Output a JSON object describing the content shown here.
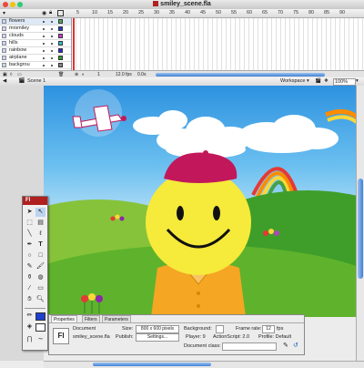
{
  "window": {
    "title": "smiley_scene.fla"
  },
  "timeline": {
    "frame_numbers": [
      "5",
      "10",
      "15",
      "20",
      "25",
      "30",
      "35",
      "40",
      "45",
      "50",
      "55",
      "60",
      "65",
      "70",
      "75",
      "80",
      "85",
      "90"
    ],
    "layers": [
      {
        "name": "flowers",
        "swatch": "#4caf50"
      },
      {
        "name": "mrsmiley",
        "swatch": "#1e3fd0"
      },
      {
        "name": "clouds",
        "swatch": "#d23fd0"
      },
      {
        "name": "hills",
        "swatch": "#25c4d6"
      },
      {
        "name": "rainbow",
        "swatch": "#2b2bd8"
      },
      {
        "name": "airplane",
        "swatch": "#30a030"
      },
      {
        "name": "backgrou",
        "swatch": "#888888"
      }
    ],
    "frame": "1",
    "fps": "12.0 fps",
    "time": "0.0s"
  },
  "editbar": {
    "scene": "Scene 1",
    "workspace": "Workspace",
    "zoom": "100%"
  },
  "tools": {
    "header": "Fl",
    "text_tool": "T"
  },
  "properties": {
    "tabs": [
      "Properties",
      "Filters",
      "Parameters"
    ],
    "doc_icon": "Fl",
    "doc_type": "Document",
    "doc_name": "smiley_scene.fla",
    "size_label": "Size:",
    "size_value": "800 x 600 pixels",
    "publish_label": "Publish:",
    "settings_button": "Settings...",
    "background_label": "Background:",
    "frame_rate_label": "Frame rate:",
    "frame_rate_value": "12",
    "fps_unit": "fps",
    "player_label": "Player: 9",
    "actionscript_label": "ActionScript: 2.0",
    "profile_label": "Profile: Default",
    "document_class_label": "Document class:"
  },
  "colors": {
    "accent_red": "#b02020",
    "sky": "#2d92e0",
    "grass": "#5fb32c",
    "smiley": "#f6ea3a",
    "beret": "#c2185b",
    "shirt": "#f5a623"
  }
}
